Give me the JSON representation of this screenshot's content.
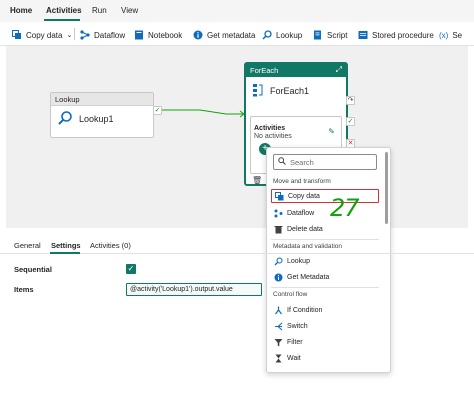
{
  "tabs": [
    "Home",
    "Activities",
    "Run",
    "View"
  ],
  "toolbar": {
    "copy_data": "Copy data",
    "dataflow": "Dataflow",
    "notebook": "Notebook",
    "get_metadata": "Get metadata",
    "lookup": "Lookup",
    "script": "Script",
    "stored_procedure": "Stored procedure",
    "expression_label": "Se"
  },
  "canvas": {
    "lookup_activity": {
      "header": "Lookup",
      "name": "Lookup1"
    },
    "foreach_activity": {
      "header": "ForEach",
      "name": "ForEach1",
      "activities_label": "Activities",
      "no_activities": "No activities"
    }
  },
  "menu": {
    "search_placeholder": "Search",
    "sections": {
      "move_transform": "Move and transform",
      "metadata_validation": "Metadata and validation",
      "control_flow": "Control flow"
    },
    "items": {
      "copy_data": "Copy data",
      "dataflow": "Dataflow",
      "delete_data": "Delete data",
      "lookup": "Lookup",
      "get_metadata": "Get Metadata",
      "if_condition": "If Condition",
      "switch": "Switch",
      "filter": "Filter",
      "wait": "Wait"
    }
  },
  "annotation": "27",
  "panel": {
    "tabs": [
      "General",
      "Settings",
      "Activities (0)"
    ],
    "sequential_label": "Sequential",
    "items_label": "Items",
    "items_value": "@activity('Lookup1').output.value"
  },
  "colors": {
    "accent": "#117865",
    "highlight": "#d13438",
    "annotation": "#13a10e"
  }
}
